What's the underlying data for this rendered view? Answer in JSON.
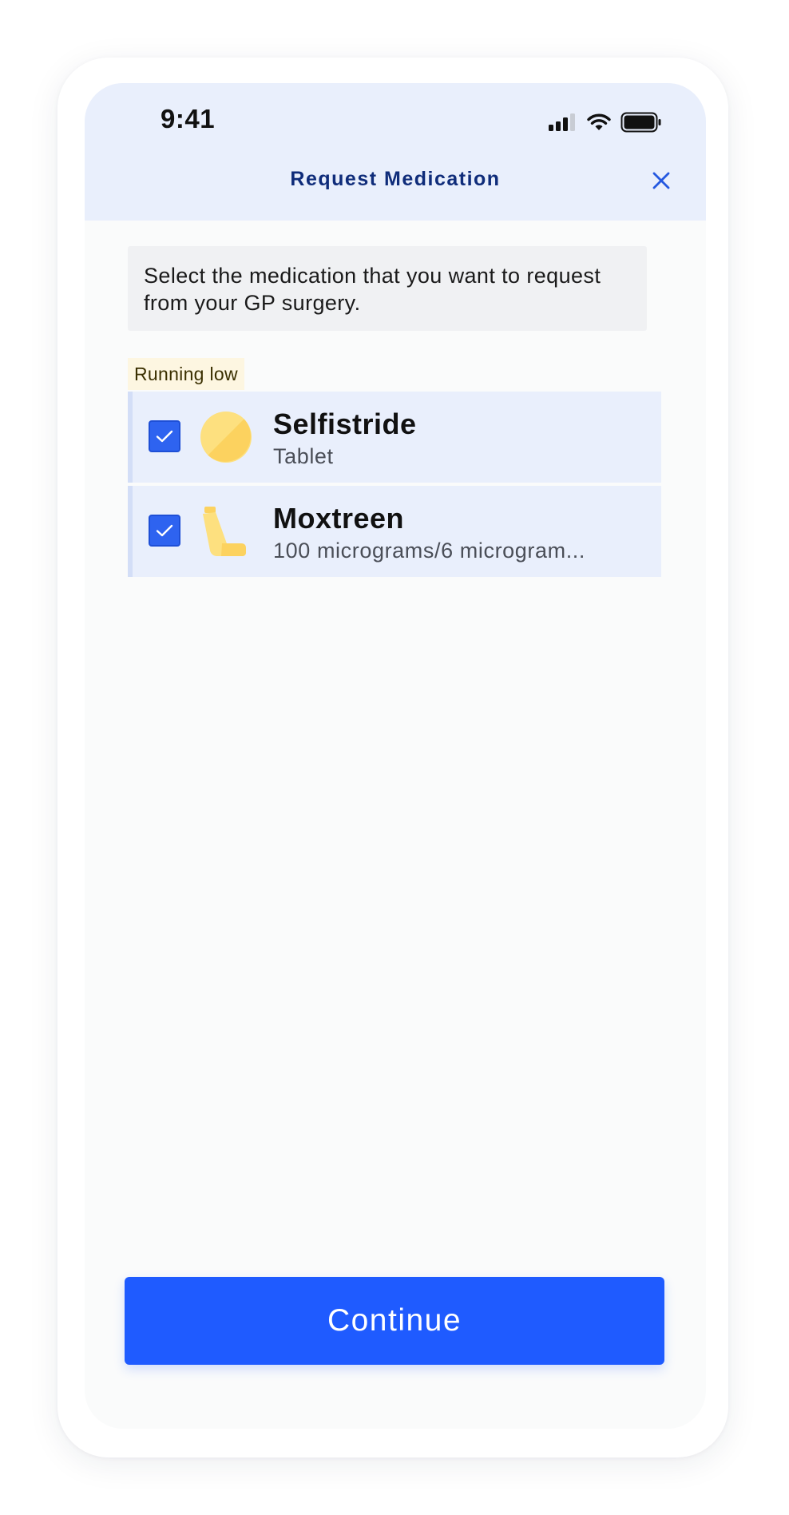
{
  "status_bar": {
    "time": "9:41",
    "icons": [
      "signal-icon",
      "wifi-icon",
      "battery-icon"
    ]
  },
  "header": {
    "title": "Request Medication",
    "close_icon": "close-icon"
  },
  "info_text": "Select the medication that you want to request from your GP surgery.",
  "tag_label": "Running low",
  "medications": [
    {
      "name": "Selfistride",
      "detail": "Tablet",
      "checked": true,
      "icon": "tablet-icon"
    },
    {
      "name": "Moxtreen",
      "detail": "100 micrograms/6 microgram...",
      "checked": true,
      "icon": "inhaler-icon"
    }
  ],
  "continue_label": "Continue",
  "colors": {
    "accent": "#1f5bff",
    "header_bg": "#e9effc",
    "title": "#0f2c7a",
    "tag_bg": "#fdf6e1",
    "icon_yellow": "#fdd66b"
  }
}
